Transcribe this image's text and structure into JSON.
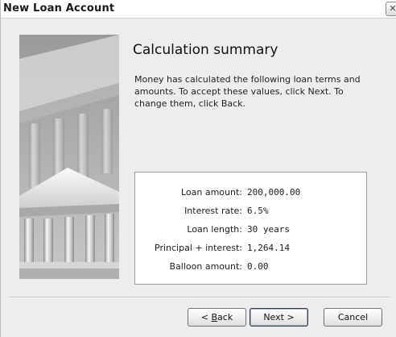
{
  "window": {
    "title": "New Loan Account",
    "close_glyph": "✕"
  },
  "page": {
    "heading": "Calculation summary",
    "description": "Money has calculated the following loan terms and amounts. To accept these values, click Next. To change them, click Back."
  },
  "summary": [
    {
      "label": "Loan amount:",
      "value": "200,000.00"
    },
    {
      "label": "Interest rate:",
      "value": "6.5%"
    },
    {
      "label": "Loan length:",
      "value": "30 years"
    },
    {
      "label": "Principal + interest:",
      "value": "1,264.14"
    },
    {
      "label": "Balloon amount:",
      "value": "0.00"
    }
  ],
  "buttons": {
    "back_prefix": "< ",
    "back_mnemonic": "B",
    "back_rest": "ack",
    "next": "Next >",
    "cancel": "Cancel"
  },
  "icons": {
    "illustration": "bank-building-icon",
    "close": "close-icon"
  }
}
